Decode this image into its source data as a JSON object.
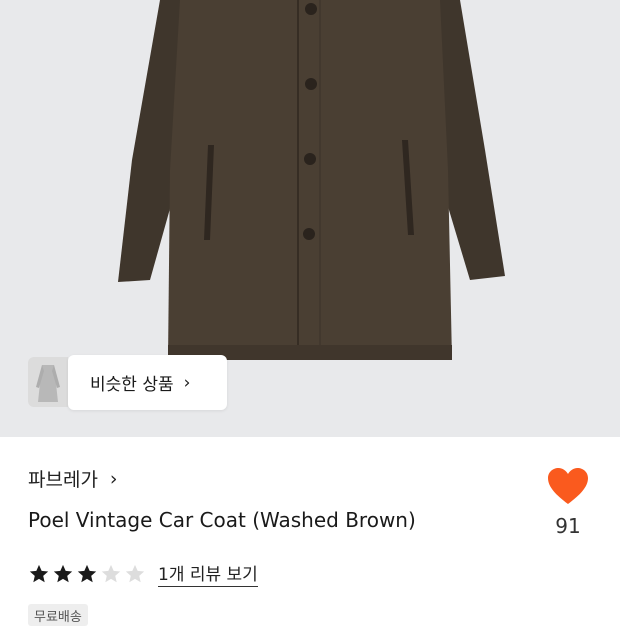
{
  "product_image": {
    "alt": "coat-photo",
    "background": "#e8e9eb",
    "coat_color": "#4a3f33"
  },
  "similar": {
    "label": "비슷한 상품",
    "chevron": "›"
  },
  "brand": {
    "name": "파브레가",
    "chevron": "›"
  },
  "product": {
    "title": "Poel Vintage Car Coat (Washed Brown)"
  },
  "like": {
    "icon": "heart-icon",
    "count": "91",
    "color": "#fa5a1e"
  },
  "rating": {
    "score": 3,
    "max": 5,
    "review_link": "1개 리뷰 보기"
  },
  "badge": {
    "label": "무료배송"
  }
}
